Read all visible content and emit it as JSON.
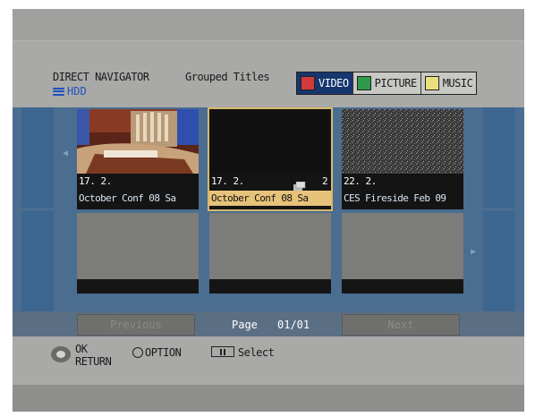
{
  "header": {
    "title": "DIRECT NAVIGATOR",
    "subtitle": "Grouped Titles",
    "drive": "HDD",
    "tabs": [
      {
        "label": "VIDEO",
        "color": "#d23b3b",
        "active": true
      },
      {
        "label": "PICTURE",
        "color": "#2f9a4a",
        "active": false
      },
      {
        "label": "MUSIC",
        "color": "#e8df7e",
        "active": false
      }
    ]
  },
  "titles": [
    {
      "date": "17. 2.",
      "name": "October Conf 08 Sa",
      "count": "",
      "selected": false
    },
    {
      "date": "17. 2.",
      "name": "October Conf 08 Sa",
      "count": "2",
      "selected": true
    },
    {
      "date": "22. 2.",
      "name": "CES Fireside Feb 09",
      "count": "",
      "selected": false
    }
  ],
  "nav": {
    "previous": "Previous",
    "page_label": "Page",
    "page_value": "01/01",
    "next": "Next"
  },
  "footer": {
    "ok": "OK",
    "return": "RETURN",
    "option": "OPTION",
    "select": "Select"
  }
}
